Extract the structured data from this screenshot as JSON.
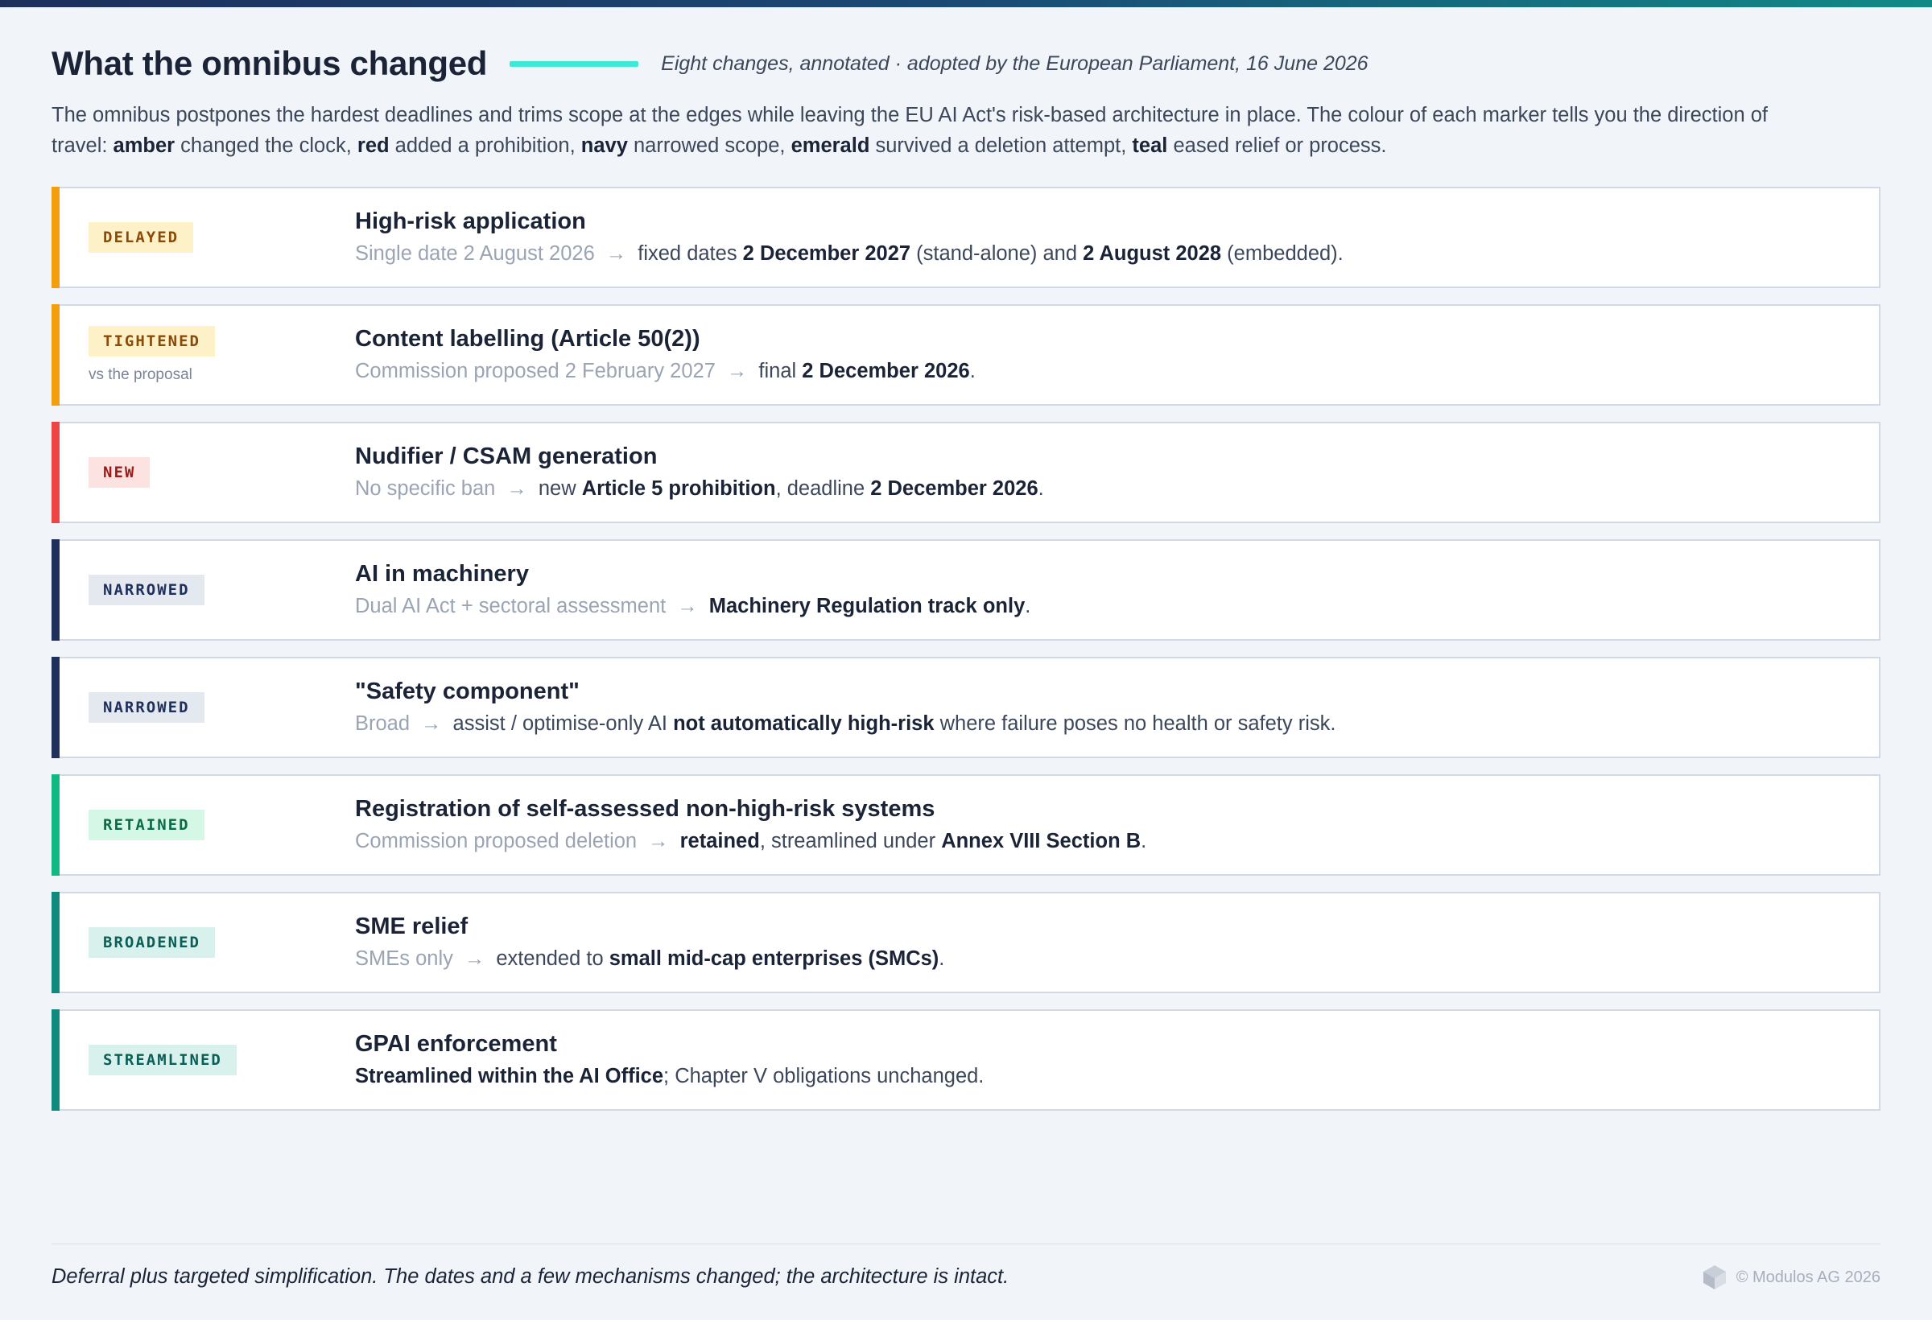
{
  "header": {
    "title": "What the omnibus changed",
    "subtitle": "Eight changes, annotated · adopted by the European Parliament, 16 June 2026"
  },
  "intro": {
    "text_before": "The omnibus postpones the hardest deadlines and trims scope at the edges while leaving the EU AI Act's risk-based architecture in place. The colour of each marker tells you the direction of travel: ",
    "legend": [
      {
        "word": "amber",
        "meaning": " changed the clock, "
      },
      {
        "word": "red",
        "meaning": " added a prohibition, "
      },
      {
        "word": "navy",
        "meaning": " narrowed scope, "
      },
      {
        "word": "emerald",
        "meaning": " survived a deletion attempt, "
      },
      {
        "word": "teal",
        "meaning": " eased relief or process."
      }
    ]
  },
  "colors": {
    "amber": "#f59e0b",
    "red": "#ef4444",
    "navy": "#1e2f5c",
    "emerald": "#10b981",
    "teal": "#0f8a7e"
  },
  "rows": [
    {
      "tag": "DELAYED",
      "tag_note": "",
      "accent": "#f59e0b",
      "tag_bg": "#fdf1c7",
      "tag_fg": "#8a4a0a",
      "title": "High-risk application",
      "before": "Single date 2 August 2026",
      "after": [
        {
          "t": "fixed dates ",
          "b": false
        },
        {
          "t": "2 December 2027",
          "b": true
        },
        {
          "t": " (stand-alone) and ",
          "b": false
        },
        {
          "t": "2 August 2028",
          "b": true
        },
        {
          "t": " (embedded).",
          "b": false
        }
      ]
    },
    {
      "tag": "TIGHTENED",
      "tag_note": "vs the proposal",
      "accent": "#f59e0b",
      "tag_bg": "#fdf1c7",
      "tag_fg": "#8a4a0a",
      "title": "Content labelling (Article 50(2))",
      "before": "Commission proposed 2 February 2027",
      "after": [
        {
          "t": "final ",
          "b": false
        },
        {
          "t": "2 December 2026",
          "b": true
        },
        {
          "t": ".",
          "b": false
        }
      ]
    },
    {
      "tag": "NEW",
      "tag_note": "",
      "accent": "#ef4444",
      "tag_bg": "#fde2e2",
      "tag_fg": "#9b1c1c",
      "title": "Nudifier / CSAM generation",
      "before": "No specific ban",
      "after": [
        {
          "t": "new ",
          "b": false
        },
        {
          "t": "Article 5 prohibition",
          "b": true
        },
        {
          "t": ", deadline ",
          "b": false
        },
        {
          "t": "2 December 2026",
          "b": true
        },
        {
          "t": ".",
          "b": false
        }
      ]
    },
    {
      "tag": "NARROWED",
      "tag_note": "",
      "accent": "#1e2f5c",
      "tag_bg": "#e4e8ef",
      "tag_fg": "#1e2f5c",
      "title": "AI in machinery",
      "before": "Dual AI Act + sectoral assessment",
      "after": [
        {
          "t": "Machinery Regulation track only",
          "b": true
        },
        {
          "t": ".",
          "b": false
        }
      ]
    },
    {
      "tag": "NARROWED",
      "tag_note": "",
      "accent": "#1e2f5c",
      "tag_bg": "#e4e8ef",
      "tag_fg": "#1e2f5c",
      "title": "\"Safety component\"",
      "before": "Broad",
      "after": [
        {
          "t": "assist / optimise-only AI ",
          "b": false
        },
        {
          "t": "not automatically high-risk",
          "b": true
        },
        {
          "t": " where failure poses no health or safety risk.",
          "b": false
        }
      ]
    },
    {
      "tag": "RETAINED",
      "tag_note": "",
      "accent": "#10b981",
      "tag_bg": "#d5f7e6",
      "tag_fg": "#0b6b4a",
      "title": "Registration of self-assessed non-high-risk systems",
      "before": "Commission proposed deletion",
      "after": [
        {
          "t": "retained",
          "b": true
        },
        {
          "t": ", streamlined under ",
          "b": false
        },
        {
          "t": "Annex VIII Section B",
          "b": true
        },
        {
          "t": ".",
          "b": false
        }
      ]
    },
    {
      "tag": "BROADENED",
      "tag_note": "",
      "accent": "#0f8a7e",
      "tag_bg": "#d8f1ec",
      "tag_fg": "#0b5f57",
      "title": "SME relief",
      "before": "SMEs only",
      "after": [
        {
          "t": "extended to ",
          "b": false
        },
        {
          "t": "small mid-cap enterprises (SMCs)",
          "b": true
        },
        {
          "t": ".",
          "b": false
        }
      ]
    },
    {
      "tag": "STREAMLINED",
      "tag_note": "",
      "accent": "#0f8a7e",
      "tag_bg": "#d8f1ec",
      "tag_fg": "#0b5f57",
      "title": "GPAI enforcement",
      "before": "",
      "after": [
        {
          "t": "Streamlined within the AI Office",
          "b": true
        },
        {
          "t": "; Chapter V obligations unchanged.",
          "b": false
        }
      ]
    }
  ],
  "footer": {
    "note": "Deferral plus targeted simplification. The dates and a few mechanisms changed; the architecture is intact.",
    "brand_icon": "cube-logo-icon",
    "copyright": "© Modulos AG 2026"
  }
}
